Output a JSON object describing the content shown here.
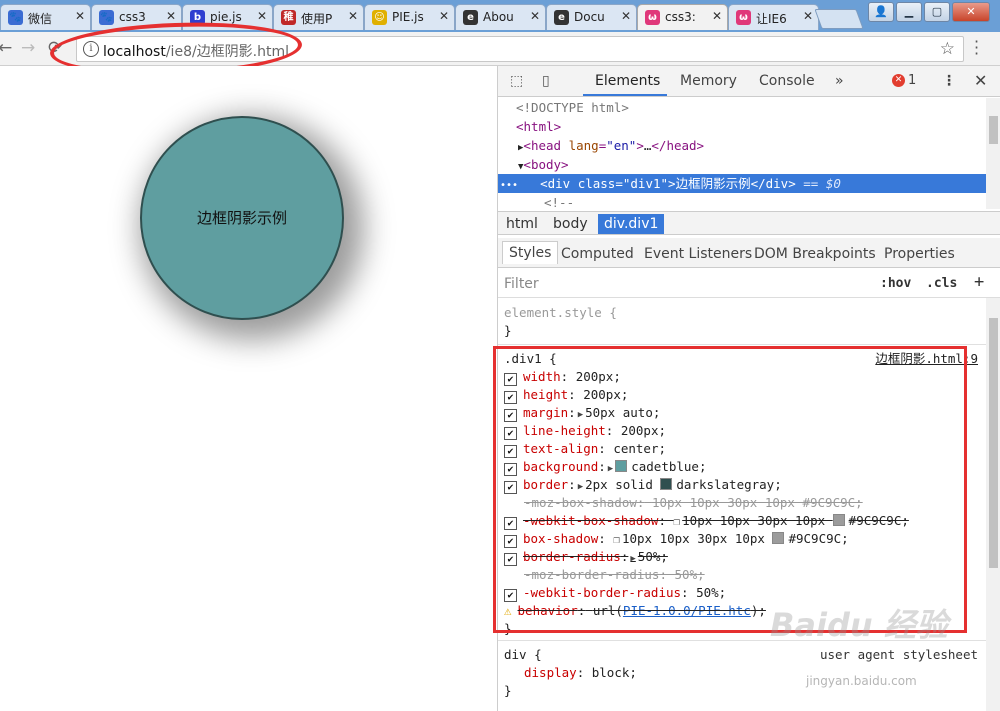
{
  "tabs": [
    {
      "title": "微信",
      "favicon_color": "#3b6cd3",
      "favicon_glyph": "🐾"
    },
    {
      "title": "css3",
      "favicon_color": "#3b6cd3",
      "favicon_glyph": "🐾"
    },
    {
      "title": "pie.js",
      "favicon_color": "#2f3fd0",
      "favicon_glyph": "b"
    },
    {
      "title": "使用P",
      "favicon_color": "#c02828",
      "favicon_glyph": "稚"
    },
    {
      "title": "PIE.js",
      "favicon_color": "#e0b000",
      "favicon_glyph": "☺"
    },
    {
      "title": "Abou",
      "favicon_color": "#333333",
      "favicon_glyph": "e"
    },
    {
      "title": "Docu",
      "favicon_color": "#333333",
      "favicon_glyph": "e"
    },
    {
      "title": "css3:",
      "favicon_color": "#e0387a",
      "favicon_glyph": "ω"
    },
    {
      "title": "让IE6",
      "favicon_color": "#e0387a",
      "favicon_glyph": "ω"
    }
  ],
  "address_bar": {
    "host": "localhost",
    "path": "/ie8/边框阴影.html"
  },
  "page": {
    "circle_text": "边框阴影示例"
  },
  "devtools": {
    "tabs": [
      "Elements",
      "Memory",
      "Console"
    ],
    "more": "»",
    "error_count": "1",
    "tree": {
      "doctype": "<!DOCTYPE html>",
      "html_open": "<html>",
      "head": {
        "tag": "head",
        "attr": "lang",
        "value": "\"en\"",
        "ellipsis": "…",
        "close": "</head>"
      },
      "body_open": "<body>",
      "selected": {
        "dots": "•••",
        "tag": "div",
        "attr": "class",
        "value": "\"div1\"",
        "text": "边框阴影示例",
        "close": "</div>",
        "eq": "== $0"
      },
      "comment": "<!--"
    },
    "breadcrumbs": [
      "html",
      "body",
      "div.div1"
    ],
    "subtabs": [
      "Styles",
      "Computed",
      "Event Listeners",
      "DOM Breakpoints",
      "Properties"
    ],
    "filter": {
      "placeholder": "Filter",
      "hov": ":hov",
      "cls": ".cls",
      "add": "+"
    },
    "styles": {
      "element_style": "element.style {",
      "close_brace": "}",
      "rule_selector": ".div1 {",
      "rule_source": "边框阴影.html:9",
      "props": [
        {
          "name": "width",
          "value": "200px;",
          "checked": true,
          "strike": false
        },
        {
          "name": "height",
          "value": "200px;",
          "checked": true,
          "strike": false
        },
        {
          "name": "margin",
          "value": "50px auto;",
          "checked": true,
          "strike": false,
          "expand": true
        },
        {
          "name": "line-height",
          "value": "200px;",
          "checked": true,
          "strike": false
        },
        {
          "name": "text-align",
          "value": "center;",
          "checked": true,
          "strike": false
        },
        {
          "name": "background",
          "value": "cadetblue;",
          "checked": true,
          "strike": false,
          "expand": true,
          "swatch": "#5f9ea0"
        },
        {
          "name": "border",
          "value": "2px solid darkslategray;",
          "checked": true,
          "strike": false,
          "expand": true,
          "swatch": "#2f4f4f",
          "swatch_after": "2px solid "
        },
        {
          "name": "-moz-box-shadow",
          "value": "10px 10px 30px 10px #9C9C9C;",
          "checked": false,
          "strike": true,
          "faded": true
        },
        {
          "name": "-webkit-box-shadow",
          "value": "10px 10px 30px 10px #9C9C9C;",
          "checked": true,
          "strike": true,
          "shadow": true,
          "swatch": "#9c9c9c"
        },
        {
          "name": "box-shadow",
          "value": "10px 10px 30px 10px #9C9C9C;",
          "checked": true,
          "strike": false,
          "shadow": true,
          "swatch": "#9c9c9c"
        },
        {
          "name": "border-radius",
          "value": "50%;",
          "checked": true,
          "strike": true,
          "expand": true
        },
        {
          "name": "-moz-border-radius",
          "value": "50%;",
          "checked": false,
          "strike": true,
          "faded": true
        },
        {
          "name": "-webkit-border-radius",
          "value": "50%;",
          "checked": true,
          "strike": false
        },
        {
          "name": "behavior",
          "value": "url(PIE-1.0.0/PIE.htc);",
          "checked": false,
          "strike": true,
          "warning": true,
          "link": "PIE-1.0.0/PIE.htc"
        }
      ],
      "div_rule": "div {",
      "div_source": "user agent stylesheet",
      "div_prop": {
        "name": "display",
        "value": "block;"
      }
    }
  },
  "watermark": {
    "brand": "Baidu 经验",
    "sub": "jingyan.baidu.com"
  }
}
